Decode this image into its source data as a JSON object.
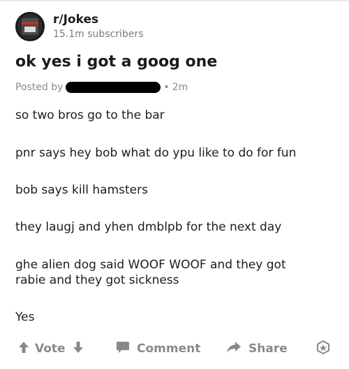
{
  "subreddit": {
    "name": "r/Jokes",
    "subscribers": "15.1m subscribers"
  },
  "post": {
    "title": "ok yes i got a goog one",
    "posted_by_label": "Posted by",
    "age": "2m",
    "paragraphs": [
      "so two bros go to the bar",
      "pnr says hey bob what do ypu like to do for fun",
      "bob says kill hamsters",
      "they laugj and yhen dmblpb for the next day",
      "ghe alien dog said WOOF WOOF and they got rabie and they got sickness",
      "Yes"
    ]
  },
  "actions": {
    "vote_label": "Vote",
    "comment_label": "Comment",
    "share_label": "Share"
  },
  "icons": {
    "upvote": "arrow-up-icon",
    "downvote": "arrow-down-icon",
    "comment": "comment-icon",
    "share": "share-icon",
    "award": "award-icon"
  },
  "colors": {
    "muted": "#878a8c",
    "text": "#1c1c1c"
  }
}
